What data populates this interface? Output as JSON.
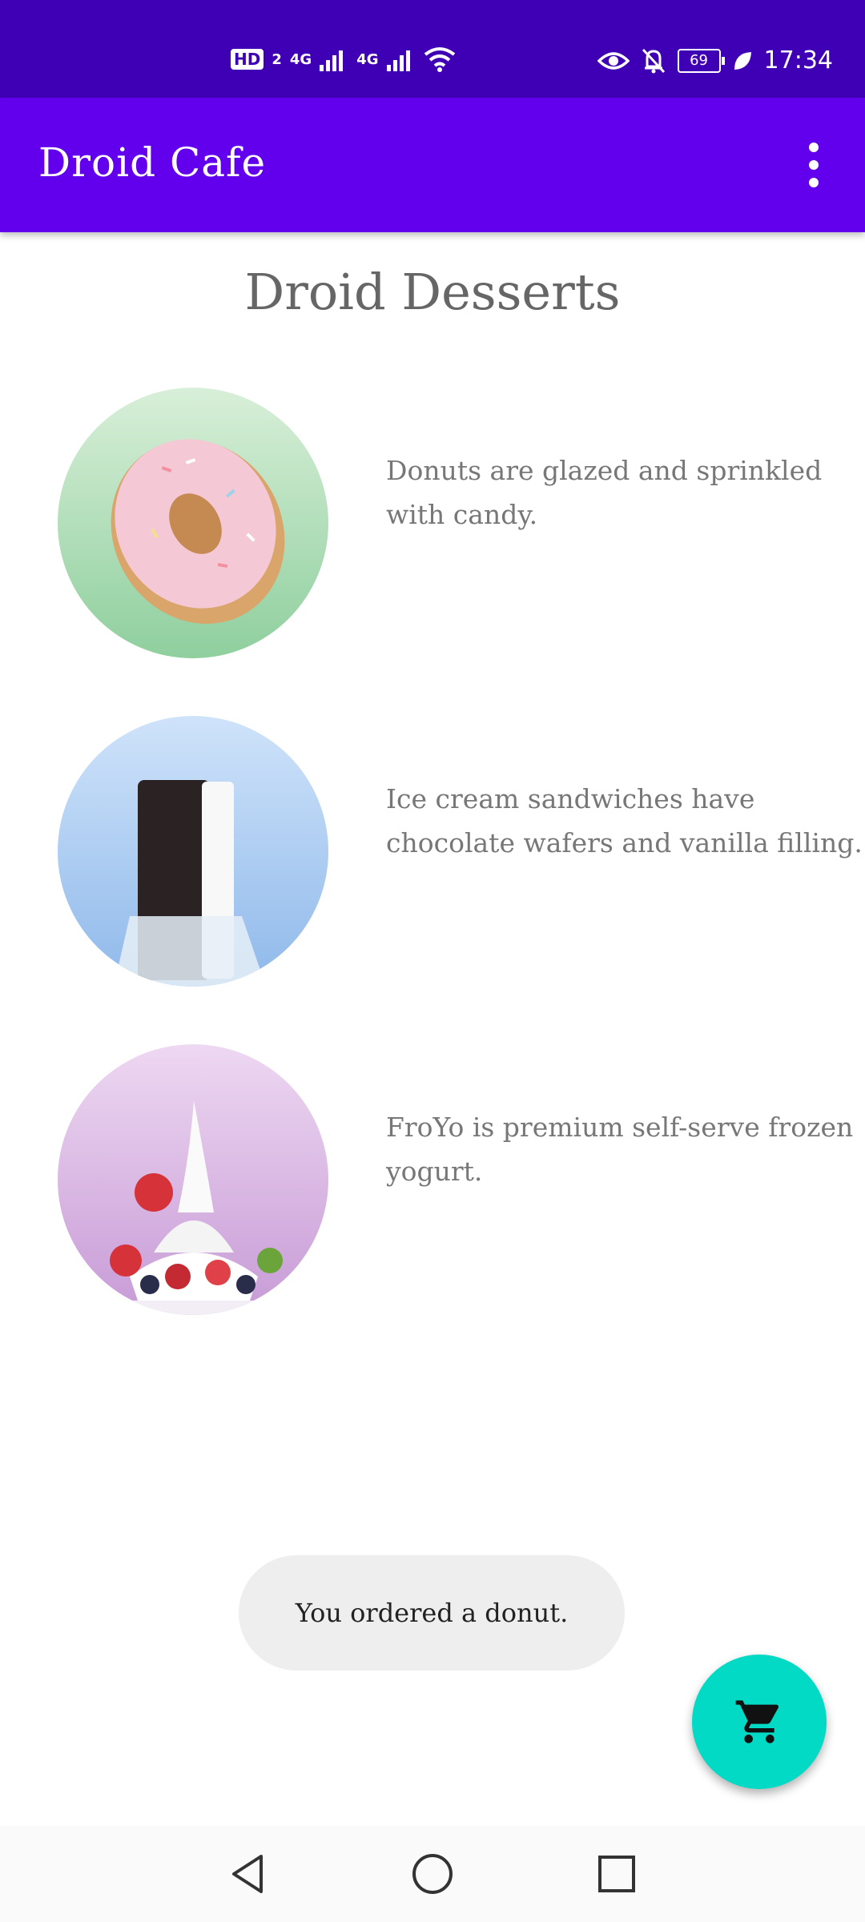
{
  "status_bar": {
    "hd_badge": "HD",
    "sim_index": "2",
    "network_1": "4G",
    "network_2": "4G",
    "battery_level": "69",
    "time": "17:34",
    "icons": [
      "hd-icon",
      "signal-icon",
      "signal-icon",
      "wifi-icon",
      "eye-icon",
      "bell-off-icon",
      "battery-icon",
      "leaf-icon"
    ]
  },
  "app_bar": {
    "title": "Droid Cafe",
    "overflow_icon": "more-vert-icon"
  },
  "page": {
    "title": "Droid Desserts"
  },
  "items": [
    {
      "name": "donut",
      "description": "Donuts are glazed and sprinkled with candy.",
      "bg_top": "#d8efd8",
      "bg_bottom": "#8fcf9e"
    },
    {
      "name": "ice-cream-sandwich",
      "description": "Ice cream sandwiches have chocolate wafers and vanilla filling.",
      "bg_top": "#cfe3fa",
      "bg_bottom": "#8fb9ea"
    },
    {
      "name": "froyo",
      "description": "FroYo is premium self-serve frozen yogurt.",
      "bg_top": "#eed8f2",
      "bg_bottom": "#c79bd6"
    }
  ],
  "toast": {
    "message": "You ordered a donut."
  },
  "fab": {
    "icon": "shopping-cart-icon",
    "color": "#03dac5"
  },
  "nav_bar": {
    "buttons": [
      "back-icon",
      "home-icon",
      "recents-icon"
    ]
  },
  "colors": {
    "status_bar": "#3f00b5",
    "primary": "#6200ee",
    "accent": "#03dac5"
  }
}
